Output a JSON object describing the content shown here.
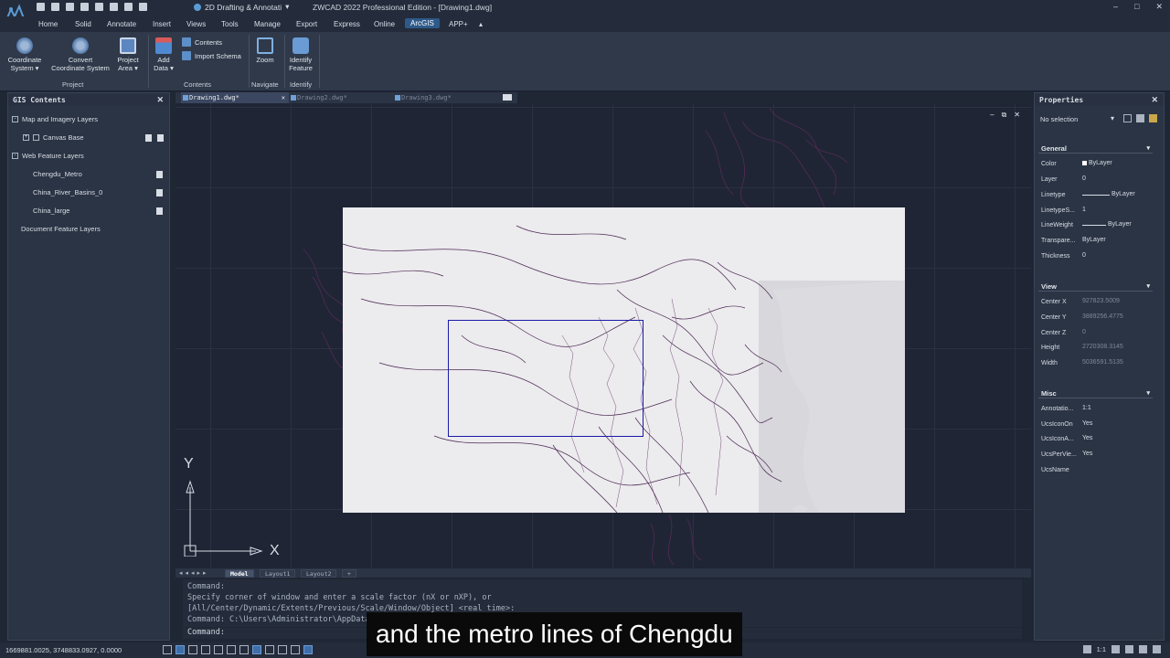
{
  "app": {
    "title": "ZWCAD 2022 Professional Edition - [Drawing1.dwg]",
    "workspace": "2D Drafting & Annotati",
    "window_controls": [
      "–",
      "□",
      "✕"
    ]
  },
  "menu": [
    "Home",
    "Solid",
    "Annotate",
    "Insert",
    "Views",
    "Tools",
    "Manage",
    "Export",
    "Express",
    "Online",
    "ArcGIS",
    "APP+"
  ],
  "menu_active": "ArcGIS",
  "ribbon": {
    "coordinate_system": "Coordinate\nSystem ▾",
    "convert_coordinate_system": "Convert\nCoordinate System",
    "project_area": "Project\nArea ▾",
    "add_data": "Add\nData ▾",
    "contents": "Contents",
    "import_schema": "Import Schema",
    "zoom": "Zoom",
    "identify_feature": "Identify\nFeature",
    "groups": [
      "Project",
      "Contents",
      "Navigate",
      "Identify"
    ]
  },
  "gis_contents": {
    "title": "GIS Contents",
    "close": "✕",
    "map_imagery_layers": "Map and Imagery Layers",
    "canvas_base": "Canvas Base",
    "web_feature_layers": "Web Feature Layers",
    "layers": [
      "Chengdu_Metro",
      "China_River_Basins_0",
      "China_large"
    ],
    "document_feature_layers": "Document Feature Layers"
  },
  "doc_tabs": [
    "Drawing1.dwg*",
    "Drawing2.dwg*",
    "Drawing3.dwg*"
  ],
  "canvas_controls": [
    "–",
    "⧉",
    "✕"
  ],
  "axis": {
    "y": "Y",
    "x": "X"
  },
  "properties": {
    "title": "Properties",
    "selection": "No selection",
    "general": {
      "title": "General",
      "rows": [
        {
          "label": "Color",
          "value": "ByLayer"
        },
        {
          "label": "Layer",
          "value": "0"
        },
        {
          "label": "Linetype",
          "value": "ByLayer"
        },
        {
          "label": "LinetypeS...",
          "value": "1"
        },
        {
          "label": "LineWeight",
          "value": "ByLayer"
        },
        {
          "label": "Transpare...",
          "value": "ByLayer"
        },
        {
          "label": "Thickness",
          "value": "0"
        }
      ]
    },
    "view": {
      "title": "View",
      "rows": [
        {
          "label": "Center X",
          "value": "927823.5009"
        },
        {
          "label": "Center Y",
          "value": "3889256.4775"
        },
        {
          "label": "Center Z",
          "value": "0"
        },
        {
          "label": "Height",
          "value": "2720308.3145"
        },
        {
          "label": "Width",
          "value": "5036591.5135"
        }
      ]
    },
    "misc": {
      "title": "Misc",
      "rows": [
        {
          "label": "Annotatio...",
          "value": "1:1"
        },
        {
          "label": "UcsIconOn",
          "value": "Yes"
        },
        {
          "label": "UcsIconA...",
          "value": "Yes"
        },
        {
          "label": "UcsPerVie...",
          "value": "Yes"
        },
        {
          "label": "UcsName",
          "value": ""
        }
      ]
    }
  },
  "layout_tabs": [
    "Model",
    "Layout1",
    "Layout2",
    "+"
  ],
  "command_history": [
    "Command:",
    "Specify corner of window and enter a scale factor (nX or nXP), or",
    "[All/Center/Dynamic/Extents/Previous/Scale/Window/Object] <real time>:",
    "Command: C:\\Users\\Administrator\\AppData\\Local\\Temp\\wmlhol_ewi8104_a.tif"
  ],
  "command_prompt": "Command:",
  "status": {
    "coords": "1669881.0025, 3748833.0927, 0.0000",
    "scale": "1:1"
  },
  "subtitle": "and the metro lines of Chengdu",
  "colors": {
    "accent": "#2e5a8a",
    "extent_box": "#1a1aa8",
    "rivers": "#5a2a5e"
  }
}
